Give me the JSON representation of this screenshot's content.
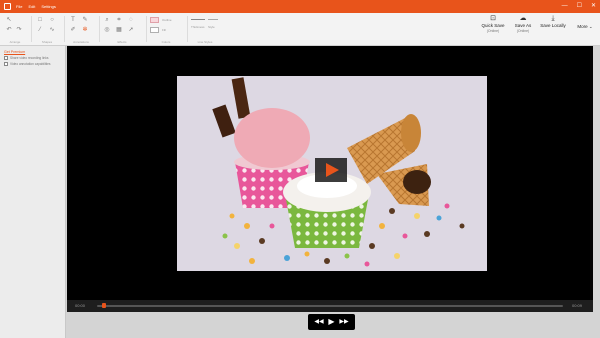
{
  "titlebar": {
    "menu": [
      "File",
      "Edit",
      "Settings"
    ],
    "window_controls": {
      "minimize": "—",
      "maximize": "☐",
      "close": "✕"
    }
  },
  "ribbon": {
    "groups": [
      {
        "label": "Arrange"
      },
      {
        "label": "Shapes"
      },
      {
        "label": "Annotations"
      },
      {
        "label": "Effects"
      },
      {
        "label": "Colors"
      },
      {
        "label": "Line Styles"
      }
    ],
    "colors": {
      "outline_label": "Outline",
      "fill_label": "Fill"
    },
    "line_styles": {
      "thickness_label": "Thickness",
      "style_label": "Style"
    },
    "actions": [
      {
        "label": "Quick Save",
        "sub": "(Online)",
        "icon": "quick-save-icon",
        "glyph": "⊡"
      },
      {
        "label": "Save As",
        "sub": "(Online)",
        "icon": "cloud-save-icon",
        "glyph": "☁"
      },
      {
        "label": "Save Locally",
        "sub": "",
        "icon": "download-icon",
        "glyph": "⤓"
      },
      {
        "label": "More",
        "sub": "",
        "icon": "chevron-down-icon",
        "glyph": "⌄"
      }
    ]
  },
  "sidebar": {
    "title": "Get Premium",
    "options": [
      "Share video recording links",
      "Video annotation capabilities"
    ]
  },
  "player": {
    "time_elapsed": "00:00",
    "time_total": "00:09",
    "progress": 0.01,
    "controls": {
      "rewind": "◀◀",
      "play": "▶",
      "forward": "▶▶"
    }
  },
  "colors": {
    "accent": "#e8541b",
    "canvas": "#000000",
    "ribbon": "#f3f3f3"
  }
}
